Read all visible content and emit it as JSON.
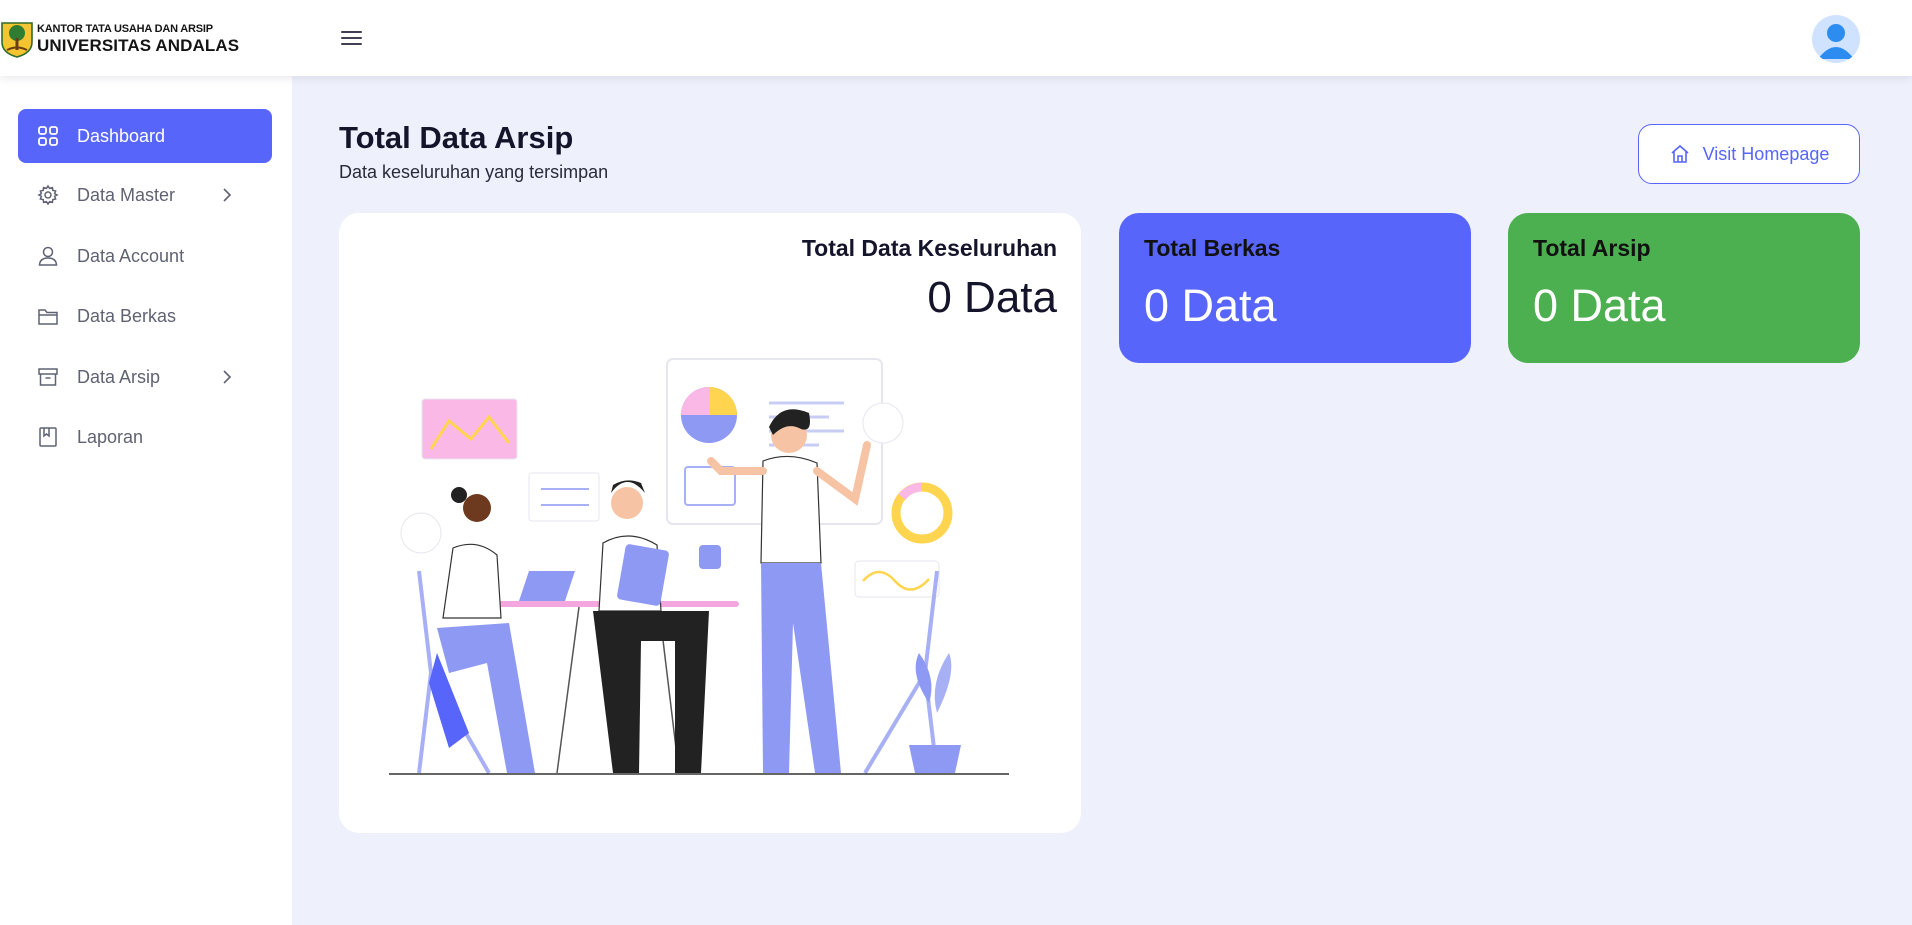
{
  "header": {
    "logo_line1": "KANTOR TATA USAHA DAN ARSIP",
    "logo_line2": "UNIVERSITAS ANDALAS"
  },
  "sidebar": {
    "items": [
      {
        "label": "Dashboard",
        "icon": "grid-icon",
        "active": true
      },
      {
        "label": "Data Master",
        "icon": "gear-icon",
        "has_submenu": true
      },
      {
        "label": "Data Account",
        "icon": "user-icon"
      },
      {
        "label": "Data Berkas",
        "icon": "folder-icon"
      },
      {
        "label": "Data Arsip",
        "icon": "archive-icon",
        "has_submenu": true
      },
      {
        "label": "Laporan",
        "icon": "book-icon"
      }
    ]
  },
  "main": {
    "title": "Total Data Arsip",
    "subtitle": "Data keseluruhan yang tersimpan",
    "visit_button": "Visit Homepage",
    "total_card": {
      "label": "Total Data Keseluruhan",
      "value": "0 Data"
    },
    "stats": [
      {
        "label": "Total Berkas",
        "value": "0 Data"
      },
      {
        "label": "Total Arsip",
        "value": "0 Data"
      }
    ]
  },
  "colors": {
    "primary": "#5865fb",
    "success": "#4caf50",
    "background": "#eef0fc",
    "sidebar_text": "#5f6273"
  }
}
